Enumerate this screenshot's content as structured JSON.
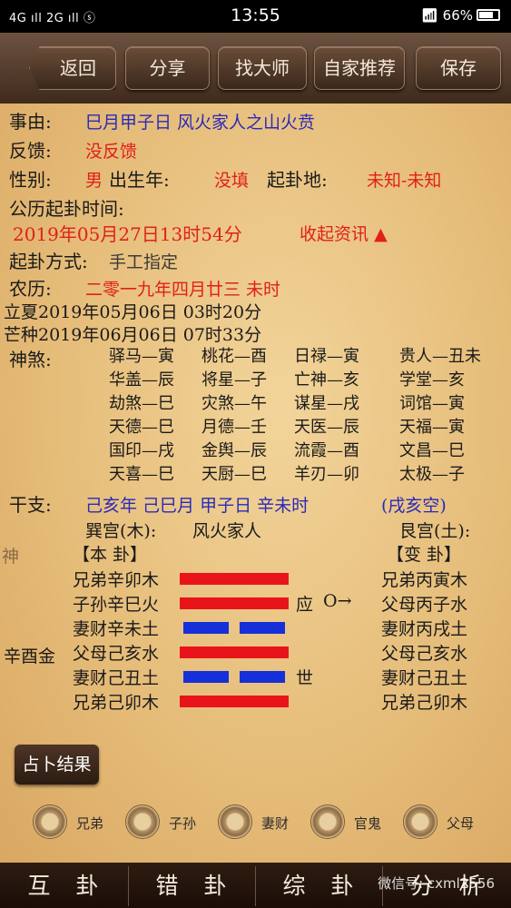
{
  "status": {
    "signal": "4G ıll 2G ıll  ⓢ",
    "time": "13:55",
    "battery": "66%"
  },
  "toolbar": {
    "back": "返回",
    "share": "分享",
    "find_master": "找大师",
    "recommend": "自家推荐",
    "save": "保存"
  },
  "info": {
    "matter_label": "事由:",
    "matter_value": "巳月甲子日 风火家人之山火贲",
    "feedback_label": "反馈:",
    "feedback_value": "没反馈",
    "gender_label": "性别:",
    "gender_value": "男",
    "birth_label": "出生年:",
    "birth_value": "没填",
    "place_label": "起卦地:",
    "place_value": "未知-未知",
    "time_label": "公历起卦时间:",
    "time_value": "2019年05月27日13时54分",
    "collect_label": "收起资讯",
    "method_label": "起卦方式:",
    "method_value": "手工指定",
    "lunar_label": "农历:",
    "lunar_value": "二零一九年四月廿三 未时",
    "term1": "立夏2019年05月06日 03时20分",
    "term2": "芒种2019年06月06日 07时33分",
    "shensha_label": "神煞:"
  },
  "shensha": [
    [
      "驿马—寅",
      "桃花—酉",
      "日禄—寅",
      "贵人—丑未"
    ],
    [
      "华盖—辰",
      "将星—子",
      "亡神—亥",
      "学堂—亥"
    ],
    [
      "劫煞—巳",
      "灾煞—午",
      "谋星—戌",
      "词馆—寅"
    ],
    [
      "天德—巳",
      "月德—壬",
      "天医—辰",
      "天福—寅"
    ],
    [
      "国印—戌",
      "金舆—辰",
      "流霞—酉",
      "文昌—巳"
    ],
    [
      "天喜—巳",
      "天厨—巳",
      "羊刃—卯",
      "太极—子"
    ]
  ],
  "ganzhi": {
    "label": "干支:",
    "value": "己亥年 己巳月 甲子日 辛未时",
    "kong": "(戌亥空)"
  },
  "gua": {
    "palace_left": "巽宫(木):",
    "name_left": "风火家人",
    "palace_right": "艮宫(土):",
    "shen_mark": "神",
    "ben_label": "【本  卦】",
    "bian_label": "【变  卦】",
    "fushen": "辛酉金",
    "ben": [
      "兄弟辛卯木",
      "子孙辛巳火",
      "妻财辛未土",
      "父母己亥水",
      "妻财己丑土",
      "兄弟己卯木"
    ],
    "bian": [
      "兄弟丙寅木",
      "父母丙子水",
      "妻财丙戌土",
      "父母己亥水",
      "妻财己丑土",
      "兄弟己卯木"
    ],
    "yao": [
      "yang",
      "yang",
      "yin",
      "yang",
      "yin",
      "yang"
    ],
    "ying": "应",
    "moving": "O→",
    "shi": "世"
  },
  "result_button": "占卜结果",
  "filters": [
    "兄弟",
    "子孙",
    "妻财",
    "官鬼",
    "父母"
  ],
  "bottom_tabs": [
    "互卦",
    "错卦",
    "综卦",
    "分析"
  ],
  "watermark": "微信号: cxml2556"
}
